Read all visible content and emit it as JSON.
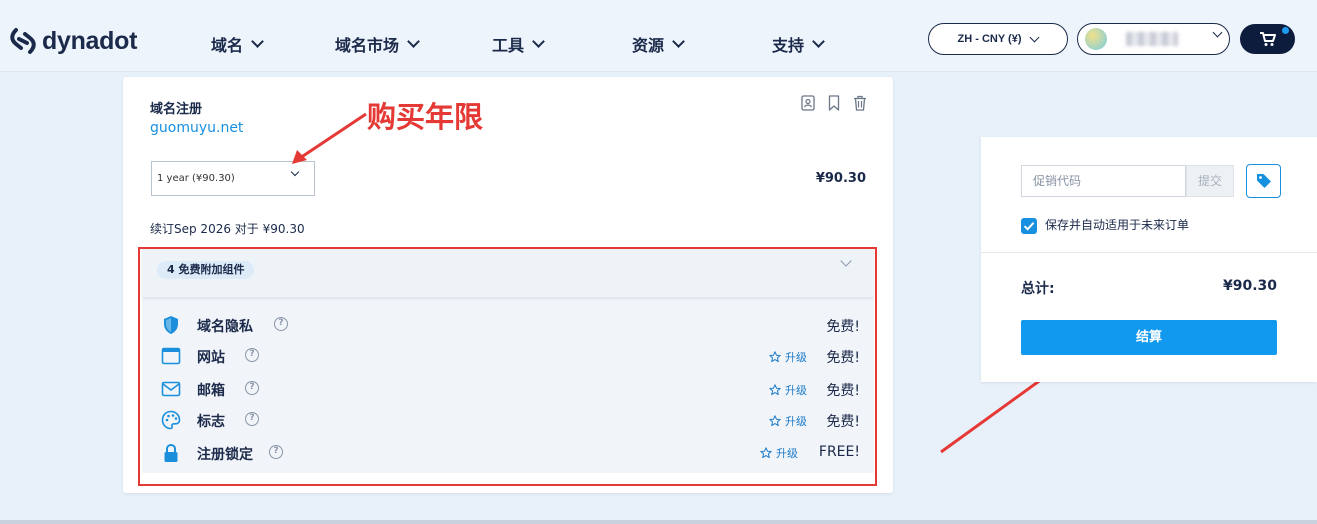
{
  "header": {
    "logo_text": "dynadot",
    "nav": [
      {
        "label": "域名"
      },
      {
        "label": "域名市场"
      },
      {
        "label": "工具"
      },
      {
        "label": "资源"
      },
      {
        "label": "支持"
      }
    ],
    "language_button": "ZH - CNY (¥)",
    "cart_icon": "cart-icon"
  },
  "cart_item": {
    "title": "域名注册",
    "domain": "guomuyu.net",
    "term_select_value": "1 year (¥90.30)",
    "price": "¥90.30",
    "renewal_text": "续订Sep 2026 对于 ¥90.30",
    "action_icons": [
      "contact-icon",
      "bookmark-icon",
      "trash-icon"
    ]
  },
  "addons": {
    "badge": "4 免费附加组件",
    "help_mark": "?",
    "upgrade_label": "升级",
    "items": [
      {
        "name": "域名隐私",
        "icon": "shield-icon",
        "price": "免费!",
        "upgrade": false
      },
      {
        "name": "网站",
        "icon": "browser-icon",
        "price": "免费!",
        "upgrade": true
      },
      {
        "name": "邮箱",
        "icon": "mail-icon",
        "price": "免费!",
        "upgrade": true
      },
      {
        "name": "标志",
        "icon": "palette-icon",
        "price": "免费!",
        "upgrade": true
      },
      {
        "name": "注册锁定",
        "icon": "lock-icon",
        "price": "FREE!",
        "upgrade": true
      }
    ]
  },
  "annotation": {
    "text": "购买年限",
    "color": "#e53935"
  },
  "summary": {
    "promo_placeholder": "促销代码",
    "submit_label": "提交",
    "save_checkbox_label": "保存并自动适用于未来订单",
    "save_checked": true,
    "total_label": "总计:",
    "total_value": "¥90.30",
    "checkout_label": "结算"
  },
  "colors": {
    "accent": "#1199f0",
    "link": "#1890e0",
    "navy": "#1b2a4a",
    "annotation_red": "#e53935"
  }
}
